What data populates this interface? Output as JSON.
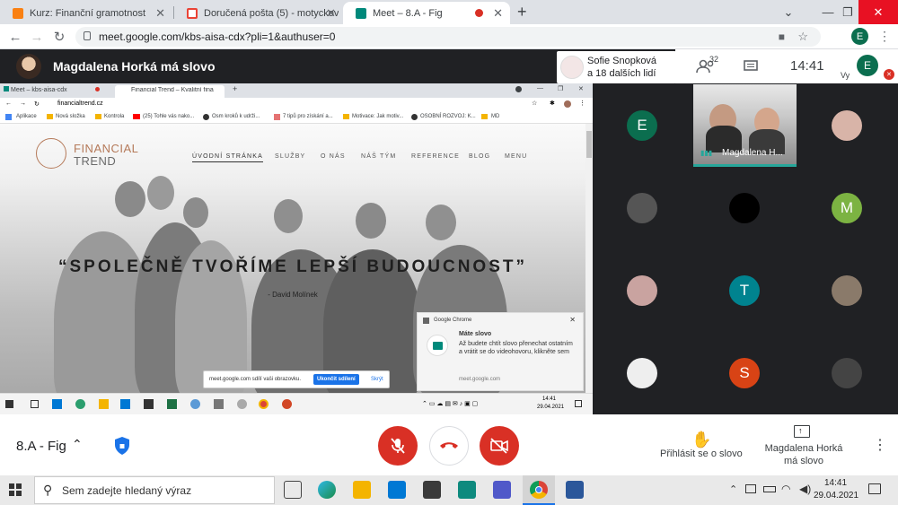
{
  "browser": {
    "tabs": [
      {
        "label": "Kurz: Finanční gramotnost",
        "icon": "moodle-icon",
        "color": "#f98012"
      },
      {
        "label": "Doručená pošta (5) - motyckova",
        "icon": "gmail-icon",
        "color": "#ea4335"
      },
      {
        "label": "Meet – 8.A - Fig",
        "icon": "meet-icon",
        "color": "#00897b"
      }
    ],
    "url": "meet.google.com/kbs-aisa-cdx?pli=1&authuser=0",
    "profile_initial": "E"
  },
  "meet": {
    "presenting_title": "Magdalena Horká má slovo",
    "participants_card": {
      "line1": "Sofie Snopková",
      "line2": "a 18 dalších lidí"
    },
    "participants_count": "32",
    "clock": "14:41",
    "self_label": "Vy",
    "self_initial": "E",
    "meeting_name": "8.A - Fig",
    "raise_hand_label": "Přihlásit se o slovo",
    "presenter_label": "Magdalena Horká má slovo",
    "active_tile_name": "Magdalena H...",
    "tiles": [
      {
        "initial": "E",
        "color": "#0b6e4f"
      },
      {
        "initial": "",
        "color": "#d8b4a8"
      },
      {
        "initial": "",
        "color": "#555555"
      },
      {
        "initial": "",
        "color": "#000000"
      },
      {
        "initial": "M",
        "color": "#7cb342"
      },
      {
        "initial": "",
        "color": "#c9a3a0"
      },
      {
        "initial": "T",
        "color": "#00838f"
      },
      {
        "initial": "",
        "color": "#8a7a6a"
      },
      {
        "initial": "",
        "color": "#eeeeee"
      },
      {
        "initial": "S",
        "color": "#d84315"
      },
      {
        "initial": "",
        "color": "#444444"
      }
    ]
  },
  "shared": {
    "tabs": [
      {
        "label": "Meet – kbs-aisa-cdx"
      },
      {
        "label": "Financial Trend – Kvalitní finanční..."
      }
    ],
    "url": "financialtrend.cz",
    "bookmarks": [
      "Aplikace",
      "Nová složka",
      "Kontrola",
      "(25) Tohle vás nako...",
      "Osm kroků k udrži...",
      "7 tipů pro získání a...",
      "Motivace: Jak motiv...",
      "OSOBNÍ ROZVOJ: K...",
      "MD"
    ],
    "site": {
      "logo_top": "FINANCIAL",
      "logo_bottom": "TREND",
      "nav": [
        "ÚVODNÍ STRÁNKA",
        "SLUŽBY",
        "O NÁS",
        "NÁŠ TÝM",
        "REFERENCE",
        "BLOG",
        "MENU"
      ],
      "headline": "“SPOLEČNĚ TVOŘÍME LEPŠÍ BUDOUCNOST”",
      "author": "- David Molínek"
    },
    "share_bar": {
      "text": "meet.google.com sdílí vaši obrazovku.",
      "stop": "Ukončit sdílení",
      "hide": "Skrýt"
    },
    "notification": {
      "app": "Google Chrome",
      "title": "Máte slovo",
      "body": "Až budete chtít slovo přenechat ostatním a vrátit se do videohovoru, klikněte sem",
      "source": "meet.google.com"
    },
    "inner_clock": {
      "time": "14:41",
      "date": "29.04.2021"
    }
  },
  "taskbar": {
    "search_placeholder": "Sem zadejte hledaný výraz",
    "time": "14:41",
    "date": "29.04.2021"
  }
}
